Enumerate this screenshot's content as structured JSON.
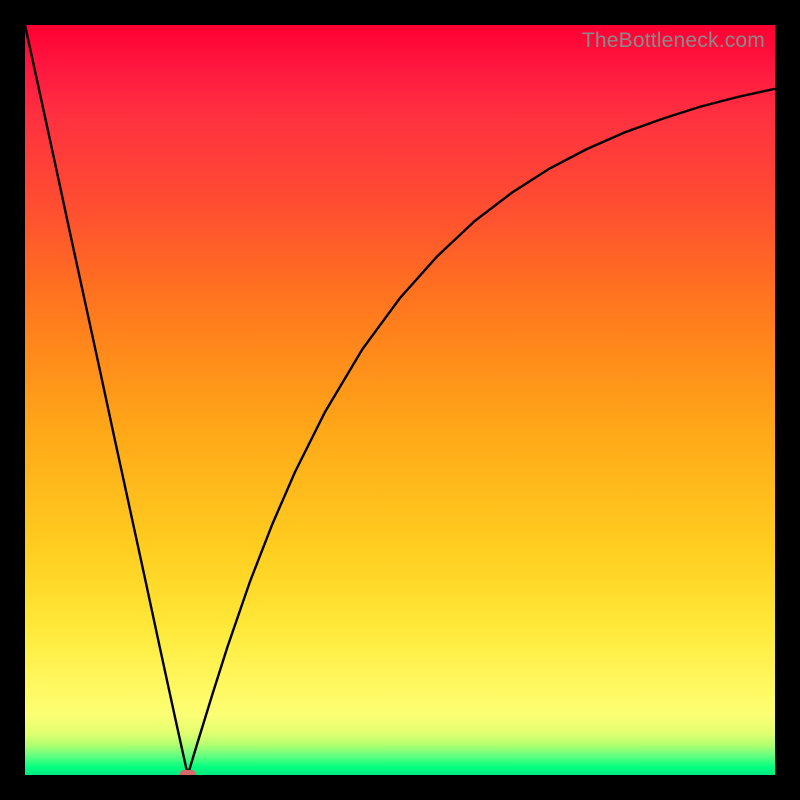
{
  "watermark": "TheBottleneck.com",
  "colors": {
    "frame": "#000000",
    "curve": "#000000",
    "marker": "#d66a6a",
    "gradient_top": "#ff0033",
    "gradient_bottom": "#00e880"
  },
  "chart_data": {
    "type": "line",
    "title": "",
    "xlabel": "",
    "ylabel": "",
    "xlim": [
      0,
      100
    ],
    "ylim": [
      0,
      100
    ],
    "x": [
      0,
      2,
      4,
      6,
      8,
      10,
      12,
      14,
      16,
      18,
      20,
      21.7,
      23,
      25,
      27,
      30,
      33,
      36,
      40,
      45,
      50,
      55,
      60,
      65,
      70,
      75,
      80,
      85,
      90,
      95,
      100
    ],
    "y": [
      100,
      90.8,
      81.6,
      72.3,
      63.1,
      53.9,
      44.6,
      35.4,
      26.2,
      16.9,
      7.7,
      0,
      4.3,
      10.8,
      17.1,
      25.8,
      33.5,
      40.4,
      48.4,
      56.8,
      63.6,
      69.2,
      73.9,
      77.7,
      80.9,
      83.5,
      85.7,
      87.5,
      89.1,
      90.4,
      91.5
    ],
    "annotations": [
      {
        "type": "marker",
        "x": 21.7,
        "y": 0,
        "shape": "rounded-rect"
      }
    ]
  }
}
